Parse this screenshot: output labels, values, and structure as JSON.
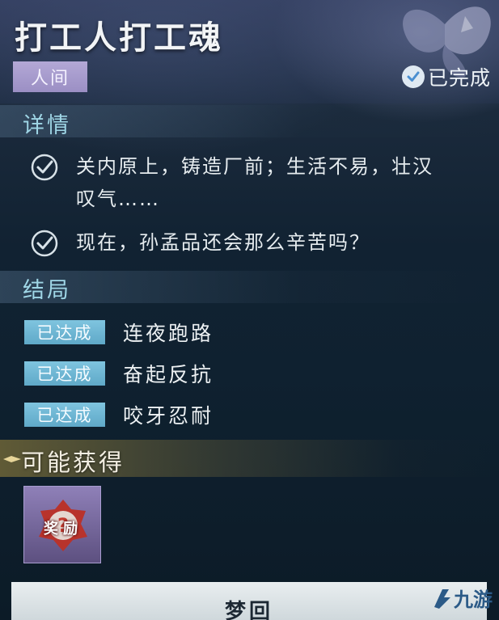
{
  "quest": {
    "title": "打工人打工魂",
    "region_tag": "人间",
    "status": "已完成"
  },
  "details": {
    "heading": "详情",
    "items": [
      {
        "line1": "关内原上，铸造厂前；生活不易，壮汉",
        "line2": "叹气……",
        "checked": true
      },
      {
        "line1": "现在，孙孟品还会那么辛苦吗？",
        "line2": "",
        "checked": true
      }
    ]
  },
  "endings": {
    "heading": "结局",
    "items": [
      {
        "badge": "已达成",
        "label": "连夜跑路"
      },
      {
        "badge": "已达成",
        "label": "奋起反抗"
      },
      {
        "badge": "已达成",
        "label": "咬牙忍耐"
      }
    ]
  },
  "rewards": {
    "heading": "可能获得",
    "item_label": "奖励",
    "item_icon": "mystery-question-icon"
  },
  "actions": {
    "dream_button": "梦回"
  },
  "watermark": {
    "text": "九游",
    "icon": "jiuyou-logo-icon"
  },
  "colors": {
    "section_title": "#9fd6e6",
    "region_tag": "#a99dd0",
    "ending_badge": "#6fb6d4",
    "reward_bar": "#967f3c"
  }
}
